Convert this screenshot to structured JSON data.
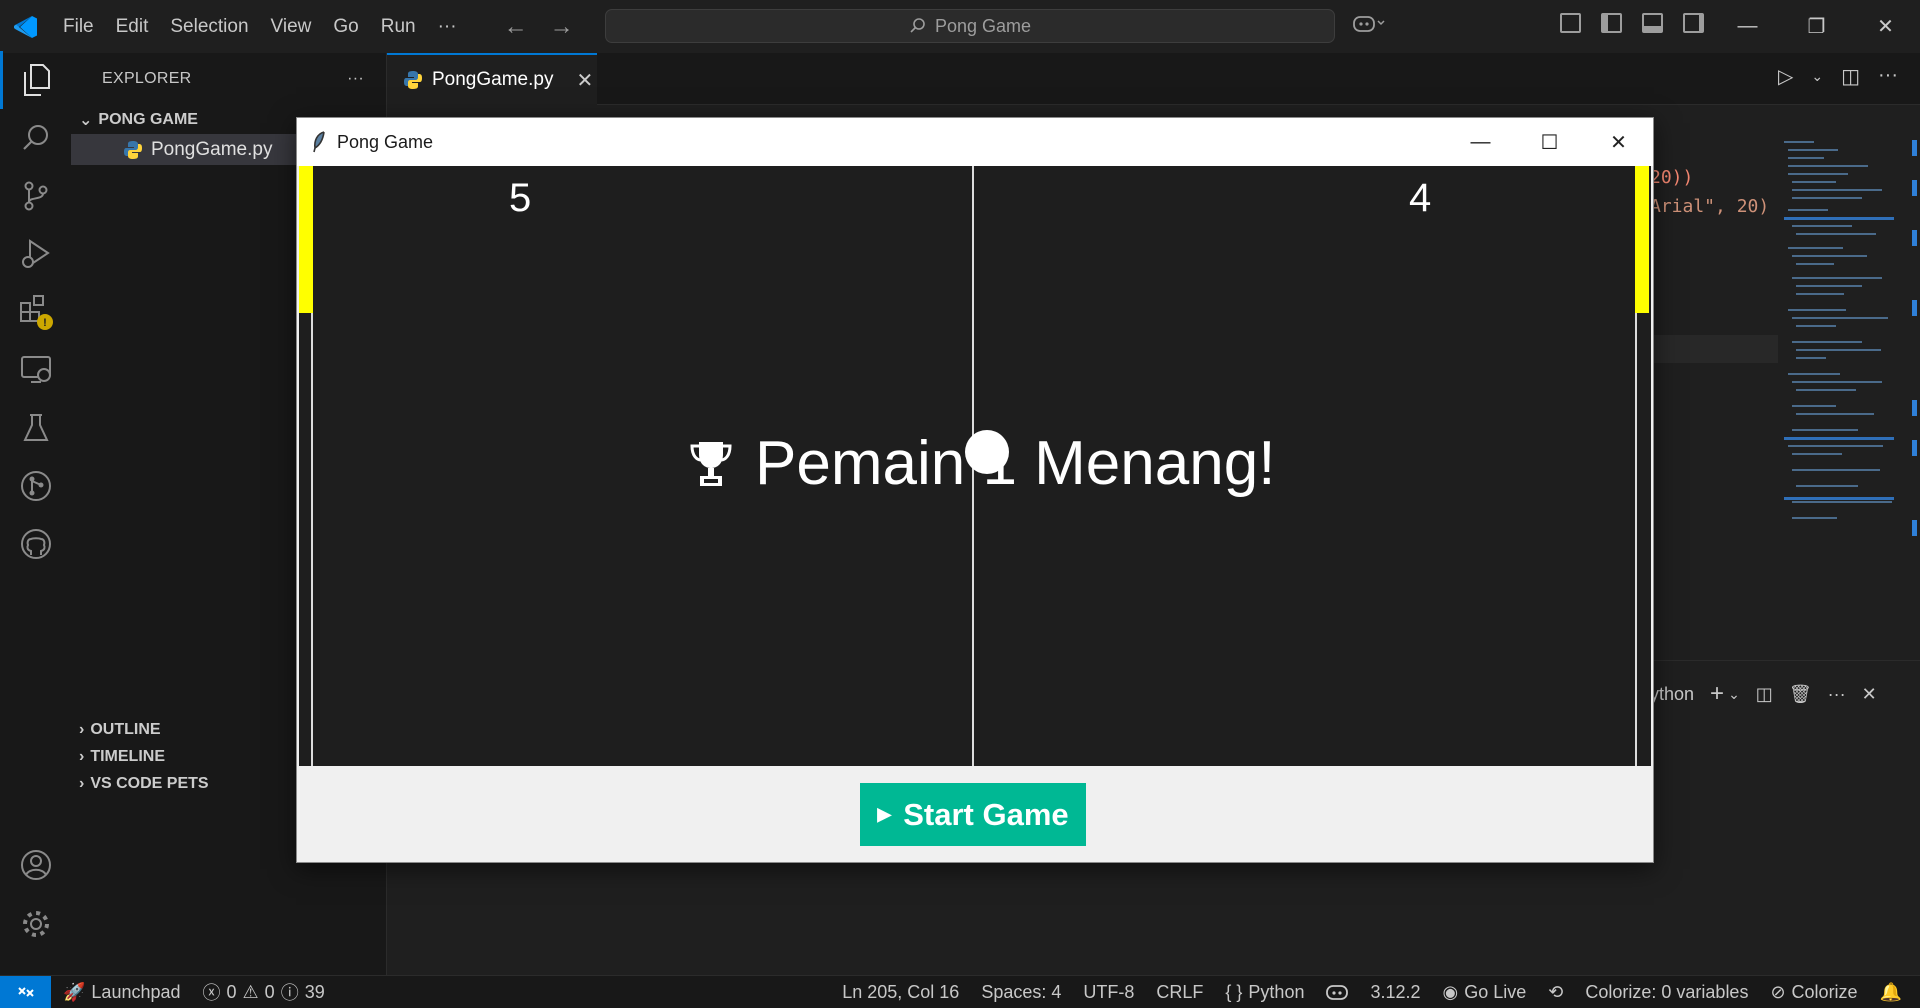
{
  "menu": [
    "File",
    "Edit",
    "Selection",
    "View",
    "Go",
    "Run",
    "···"
  ],
  "search": {
    "text": "Pong Game"
  },
  "sidebar": {
    "title": "EXPLORER",
    "more": "···",
    "folder": "PONG GAME",
    "file": "PongGame.py",
    "sections": [
      "OUTLINE",
      "TIMELINE",
      "VS CODE PETS"
    ]
  },
  "editor": {
    "tab_label": "PongGame.py",
    "code_line1": "20))",
    "code_line2": "Arial\", 20)",
    "terminal_label": "ython"
  },
  "pong": {
    "window_title": "Pong Game",
    "score_left": "5",
    "score_right": "4",
    "winner_text": "Pemain 1 Menang!",
    "trophy_icon": "trophy-icon",
    "start_label": "Start Game",
    "paddle_color": "#ffff00",
    "button_color": "#00b894"
  },
  "statusbar": {
    "launchpad": "Launchpad",
    "errors": "0",
    "warnings": "0",
    "info": "39",
    "position": "Ln 205, Col 16",
    "spaces": "Spaces: 4",
    "encoding": "UTF-8",
    "eol": "CRLF",
    "language": "Python",
    "python_version": "3.12.2",
    "go_live": "Go Live",
    "colorize_vars": "Colorize: 0 variables",
    "colorize": "Colorize"
  },
  "colors": {
    "accent": "#0078d4",
    "background": "#1f1f1f"
  }
}
